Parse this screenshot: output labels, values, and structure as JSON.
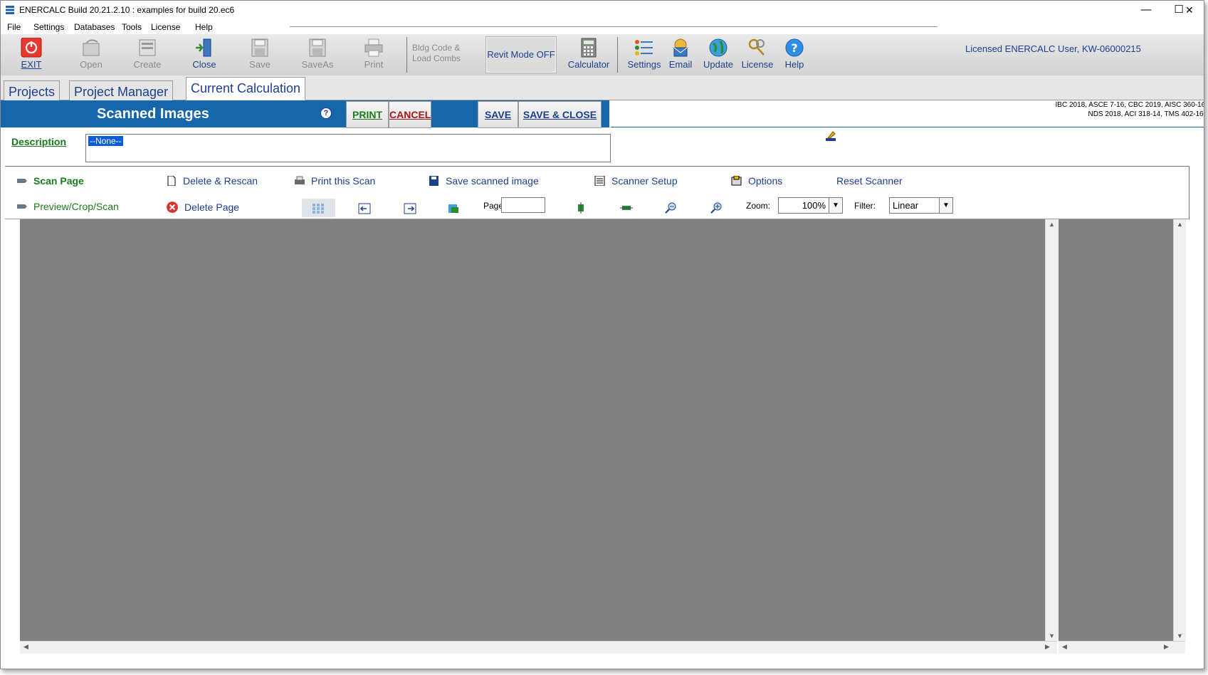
{
  "window": {
    "title": "ENERCALC Build 20.21.2.10 :  examples for build 20.ec6",
    "minimize": "—",
    "maximize": "☐",
    "close": "✕"
  },
  "menu": [
    "File",
    "Settings",
    "Databases",
    "Tools",
    "License",
    "Help"
  ],
  "toolbar": {
    "exit": "EXIT",
    "open": "Open",
    "create": "Create",
    "close": "Close",
    "save": "Save",
    "saveas": "SaveAs",
    "print": "Print",
    "bldg_code": "Bldg Code & Load Combs",
    "revit_mode": "Revit Mode OFF",
    "calculator": "Calculator",
    "settings": "Settings",
    "email": "Email",
    "update": "Update",
    "license": "License",
    "help": "Help",
    "licensed_user": "Licensed ENERCALC User, KW-06000215"
  },
  "tabs": [
    "Projects",
    "Project Manager",
    "Current Calculation"
  ],
  "header": {
    "title": "Scanned Images",
    "help": "?",
    "print": "PRINT",
    "cancel": "CANCEL",
    "save": "SAVE",
    "save_close": "SAVE & CLOSE",
    "code_note": "IBC 2018, ASCE 7-16, CBC 2019, AISC 360-16, NDS 2018, ACI 318-14, TMS 402-16 |"
  },
  "description": {
    "label": "Description",
    "value": "--None--"
  },
  "scanner": {
    "scan_page": "Scan Page",
    "delete_rescan": "Delete & Rescan",
    "print_scan": "Print this Scan",
    "save_image": "Save scanned image",
    "scanner_setup": "Scanner Setup",
    "options": "Options",
    "reset_scanner": "Reset Scanner",
    "preview": "Preview/Crop/Scan",
    "delete_page": "Delete Page",
    "page_label": "Page:",
    "page_value": "",
    "zoom_label": "Zoom:",
    "zoom_value": "100%",
    "filter_label": "Filter:",
    "filter_value": "Linear"
  }
}
